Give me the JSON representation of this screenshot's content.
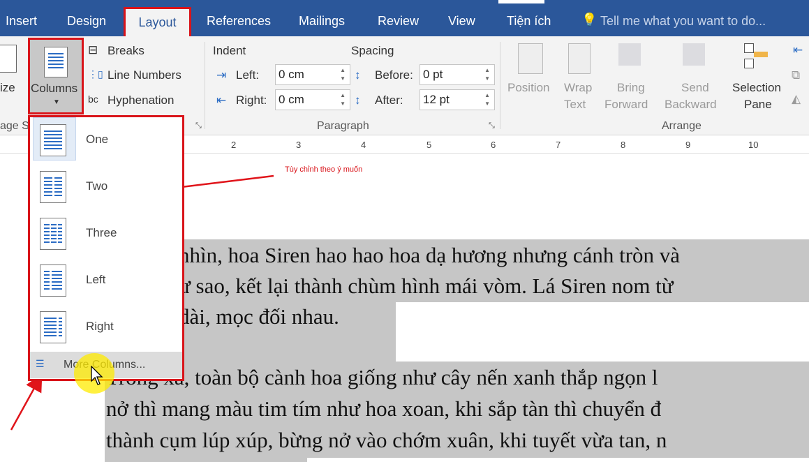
{
  "tabs": [
    "Insert",
    "Design",
    "Layout",
    "References",
    "Mailings",
    "Review",
    "View",
    "Tiện ích"
  ],
  "active_tab": "Layout",
  "tell_me": "Tell me what you want to do...",
  "page_setup": {
    "size_label": "ize",
    "group_label": "age S",
    "columns_label": "Columns",
    "breaks": "Breaks",
    "line_numbers": "Line Numbers",
    "hyphenation": "Hyphenation"
  },
  "paragraph": {
    "indent_label": "Indent",
    "spacing_label": "Spacing",
    "left_label": "Left:",
    "right_label": "Right:",
    "before_label": "Before:",
    "after_label": "After:",
    "left_value": "0 cm",
    "right_value": "0 cm",
    "before_value": "0 pt",
    "after_value": "12 pt",
    "group_label": "Paragraph"
  },
  "arrange": {
    "position": "Position",
    "wrap1": "Wrap",
    "wrap2": "Text",
    "bring1": "Bring",
    "bring2": "Forward",
    "send1": "Send",
    "send2": "Backward",
    "sel1": "Selection",
    "sel2": "Pane",
    "group_label": "Arrange"
  },
  "ruler": [
    "2",
    "3",
    "4",
    "5",
    "6",
    "7",
    "8",
    "9",
    "10"
  ],
  "columns_menu": {
    "items": [
      "One",
      "Two",
      "Three",
      "Left",
      "Right"
    ],
    "more": "More Columns..."
  },
  "annotation": "Tùy chỉnh theo ý muốn",
  "document": {
    "lines": [
      "nhìn, hoa Siren hao hao hoa dạ hương nhưng cánh tròn và",
      "ư sao, kết lại thành chùm hình mái vòm. Lá Siren nom từ",
      "dài, mọc đối nhau.",
      "Trông xa, toàn bộ cành hoa giống như cây nến xanh thắp ngọn l",
      "nở thì mang màu tim tím như hoa xoan, khi sắp tàn thì chuyển đ",
      "thành cụm lúp xúp, bừng nở vào chớm xuân, khi tuyết vừa tan, n"
    ]
  },
  "colors": {
    "tabbar": "#2b579a",
    "highlight": "#d9141a",
    "selection": "#c6c6c6"
  }
}
